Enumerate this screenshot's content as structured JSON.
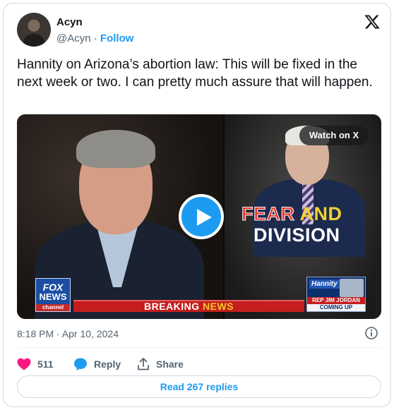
{
  "author": {
    "name": "Acyn",
    "handle": "@Acyn",
    "separator": "·",
    "follow_label": "Follow"
  },
  "tweet": {
    "text": "Hannity on Arizona’s abortion law: This will be fixed in the next week or two. I can pretty much assure that will happen.",
    "timestamp": "8:18 PM · Apr 10, 2024"
  },
  "media": {
    "watch_label": "Watch on X",
    "fear_word1": "FEAR",
    "fear_word2": " AND",
    "fear_line2": "DIVISION",
    "fox_l1": "FOX",
    "fox_l2": "NEWS",
    "fox_l3": "channel",
    "breaking_word1": "BREAKING ",
    "breaking_word2": "NEWS",
    "hannity_logo": "Hannity",
    "hannity_caption1": "REP JIM JORDAN",
    "hannity_caption2": "COMING UP"
  },
  "actions": {
    "like_count": "511",
    "reply_label": "Reply",
    "share_label": "Share"
  },
  "read_replies_label": "Read 267 replies",
  "colors": {
    "accent": "#1d9bf0",
    "like": "#f91880",
    "secondary_text": "#536471",
    "border": "#cfd9de"
  }
}
